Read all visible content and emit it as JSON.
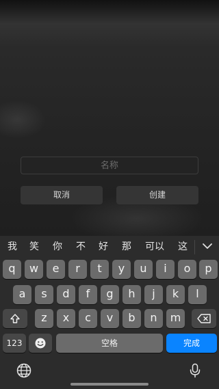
{
  "dialog": {
    "name_placeholder": "名称",
    "cancel_label": "取消",
    "create_label": "创建"
  },
  "keyboard": {
    "candidates": [
      "我",
      "笑",
      "你",
      "不",
      "好",
      "那",
      "可以",
      "这"
    ],
    "row1": [
      "q",
      "w",
      "e",
      "r",
      "t",
      "y",
      "u",
      "i",
      "o",
      "p"
    ],
    "row2": [
      "a",
      "s",
      "d",
      "f",
      "g",
      "h",
      "j",
      "k",
      "l"
    ],
    "row3": [
      "z",
      "x",
      "c",
      "v",
      "b",
      "n",
      "m"
    ],
    "numbers_label": "123",
    "space_label": "空格",
    "done_label": "完成",
    "icons": {
      "collapse": "chevron-down-icon",
      "shift": "shift-icon",
      "delete": "backspace-icon",
      "emoji": "emoji-icon",
      "globe": "globe-icon",
      "mic": "microphone-icon"
    }
  }
}
